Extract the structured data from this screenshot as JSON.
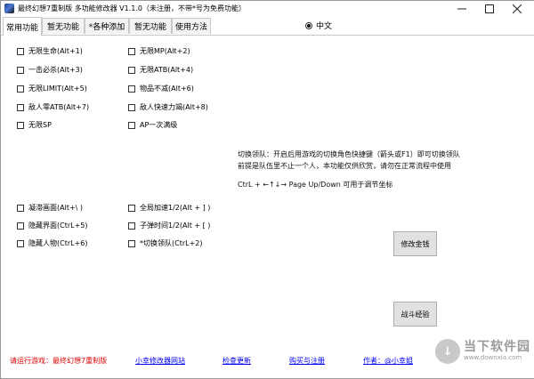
{
  "window": {
    "title": "最终幻想7重制版 多功能修改器  V1.1.0（未注册，不带*号为免费功能）"
  },
  "tabs": [
    {
      "label": "常用功能",
      "active": true
    },
    {
      "label": "暂无功能",
      "active": false
    },
    {
      "label": "*各种添加",
      "active": false
    },
    {
      "label": "暂无功能",
      "active": false
    },
    {
      "label": "使用方法",
      "active": false
    }
  ],
  "language": {
    "label": "中文",
    "selected": true
  },
  "options_top": {
    "left": [
      {
        "label": "无限生命(Alt+1)",
        "checked": false
      },
      {
        "label": "一击必杀(Alt+3)",
        "checked": false
      },
      {
        "label": "无限LIMIT(Alt+5)",
        "checked": false
      },
      {
        "label": "敌人零ATB(Alt+7)",
        "checked": false
      },
      {
        "label": "无限SP",
        "checked": false
      }
    ],
    "right": [
      {
        "label": "无限MP(Alt+2)",
        "checked": false
      },
      {
        "label": "无限ATB(Alt+4)",
        "checked": false
      },
      {
        "label": "物品不减(Alt+6)",
        "checked": false
      },
      {
        "label": "敌人快速力竭(Alt+8)",
        "checked": false
      },
      {
        "label": "AP一次满级",
        "checked": false
      }
    ]
  },
  "info": {
    "line1": "切换领队：开启后用游戏的切换角色快捷键（箭头或F1）即可切换领队",
    "line2": "前提是队伍里不止一个人，本功能仅供欣赏，请勿在正常流程中使用",
    "line3": "CtrL + ←↑↓→  Page Up/Down 可用于调节坐标"
  },
  "options_bottom": {
    "left": [
      {
        "label": "凝滞画面(Alt+\\ )",
        "checked": false
      },
      {
        "label": "隐藏界面(CtrL+5)",
        "checked": false
      },
      {
        "label": "隐藏人物(CtrL+6)",
        "checked": false
      }
    ],
    "right": [
      {
        "label": "全局加速1/2(Alt + ] )",
        "checked": false
      },
      {
        "label": "子弹时间1/2(Alt + [ )",
        "checked": false
      },
      {
        "label": "*切换领队(CtrL+2)",
        "checked": false
      }
    ]
  },
  "buttons": {
    "money": "修改金钱",
    "exp": "战斗经验"
  },
  "footer": {
    "game_status": "请运行游戏：最终幻想7重制版",
    "site_link": "小幸修改器网站",
    "update_link": "检查更新",
    "register_link": "购买与注册",
    "author_link": "作者：@小幸姐"
  },
  "watermark": {
    "logo": "↓",
    "main": "当下软件园",
    "sub": "www.downxia.com"
  }
}
